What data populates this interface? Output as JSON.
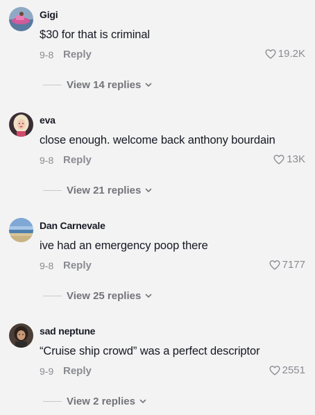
{
  "comments": [
    {
      "username": "Gigi",
      "text": "$30 for that is criminal",
      "date": "9-8",
      "reply_label": "Reply",
      "likes": "19.2K",
      "view_replies": "View 14 replies",
      "avatar": "avatar-pink-jetski"
    },
    {
      "username": "eva",
      "text": "close enough. welcome back anthony bourdain",
      "date": "9-8",
      "reply_label": "Reply",
      "likes": "13K",
      "view_replies": "View 21 replies",
      "avatar": "avatar-blonde-person"
    },
    {
      "username": "Dan Carnevale",
      "text": "ive had an emergency poop there",
      "date": "9-8",
      "reply_label": "Reply",
      "likes": "7177",
      "view_replies": "View 25 replies",
      "avatar": "avatar-beach-sky"
    },
    {
      "username": "sad neptune",
      "text": "“Cruise ship crowd” was a perfect descriptor",
      "date": "9-9",
      "reply_label": "Reply",
      "likes": "2551",
      "view_replies": "View 2 replies",
      "avatar": "avatar-dark-person"
    }
  ],
  "colors": {
    "background": "#f3f3f3",
    "primary_text": "#161823",
    "secondary_text": "#8a8b91",
    "replies_text": "#73747a"
  }
}
